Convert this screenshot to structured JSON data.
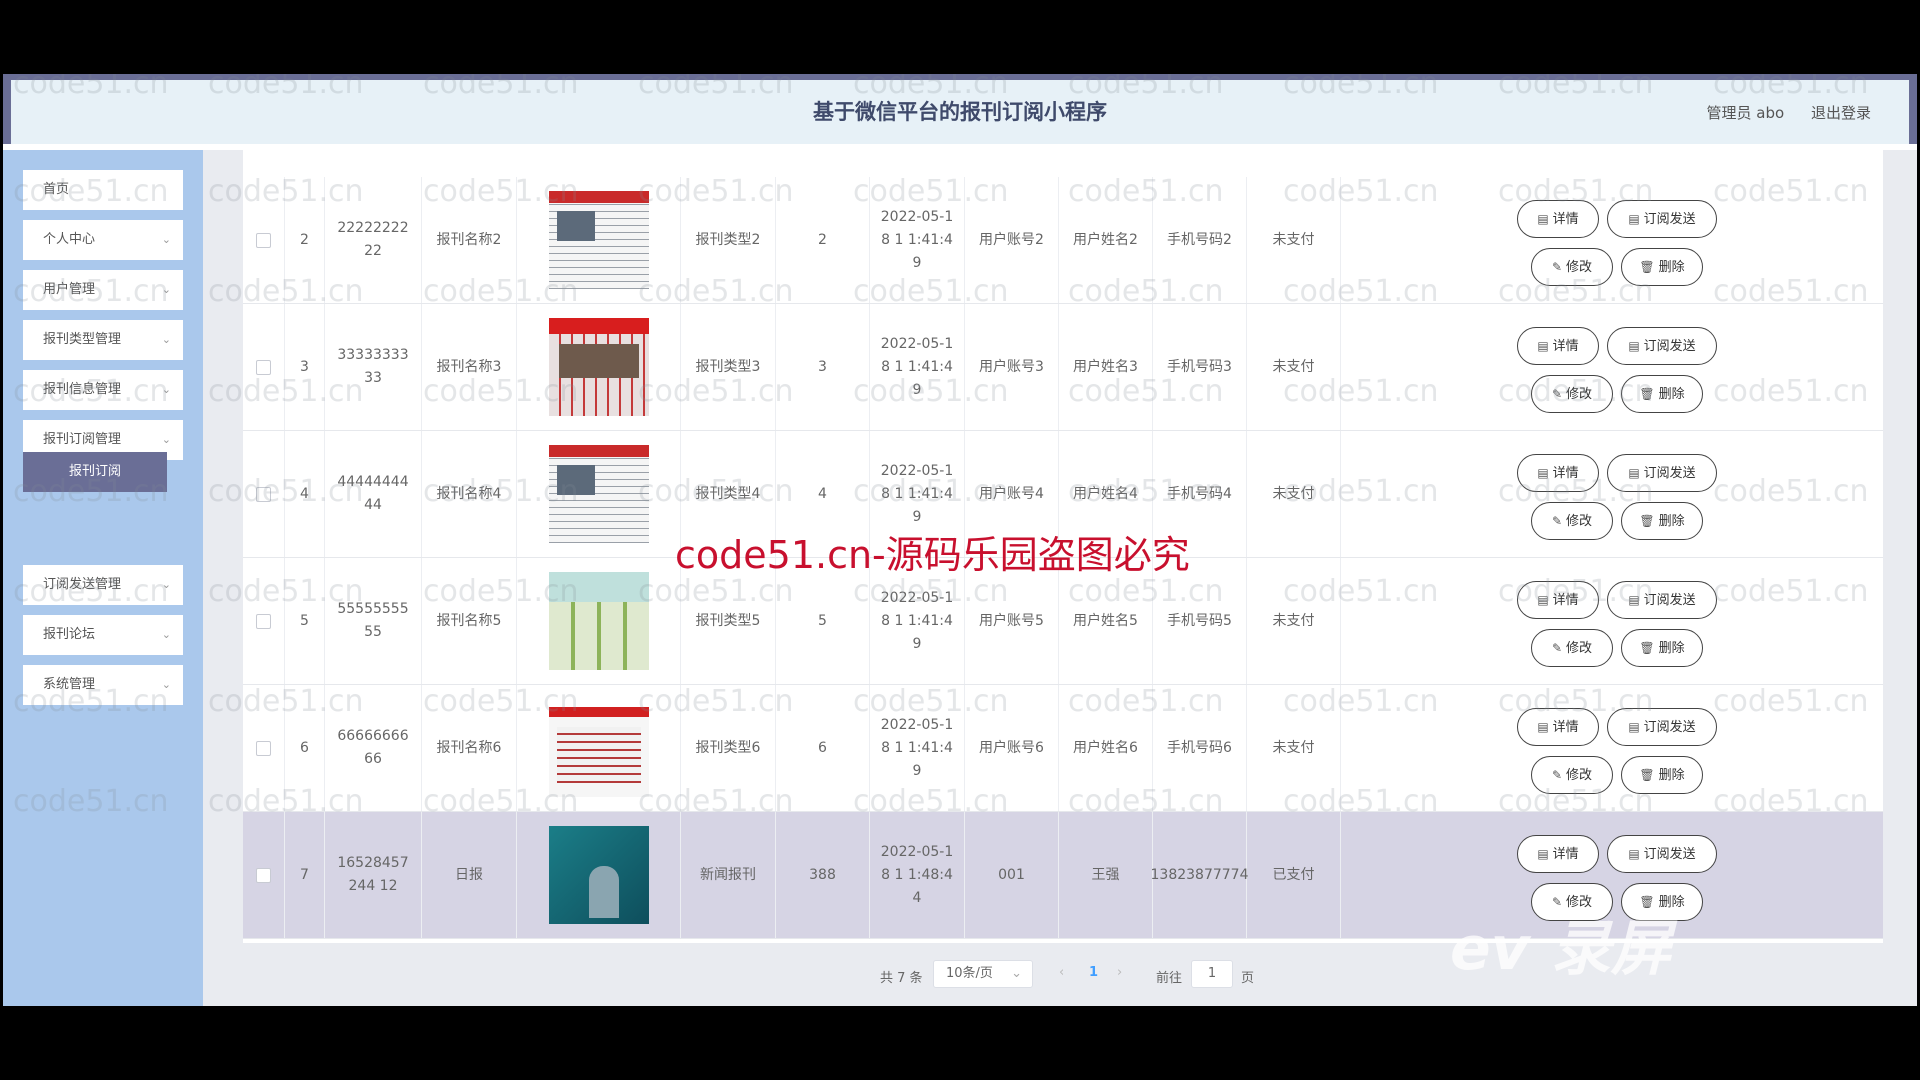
{
  "header": {
    "title": "基于微信平台的报刊订阅小程序",
    "user_label": "管理员 abo",
    "logout_label": "退出登录"
  },
  "sidebar": {
    "items": [
      {
        "label": "首页",
        "has_chevron": false
      },
      {
        "label": "个人中心",
        "has_chevron": true
      },
      {
        "label": "用户管理",
        "has_chevron": true
      },
      {
        "label": "报刊类型管理",
        "has_chevron": true
      },
      {
        "label": "报刊信息管理",
        "has_chevron": true
      },
      {
        "label": "报刊订阅管理",
        "has_chevron": true
      },
      {
        "label": "订阅发送管理",
        "has_chevron": true
      },
      {
        "label": "报刊论坛",
        "has_chevron": true
      },
      {
        "label": "系统管理",
        "has_chevron": true
      }
    ],
    "active_sub": "报刊订阅"
  },
  "rows": [
    {
      "idx": "2",
      "code": "2222222222",
      "name": "报刊名称2",
      "type": "报刊类型2",
      "count": "2",
      "time": "2022-05-18 1 1:41:49",
      "account": "用户账号2",
      "username": "用户姓名2",
      "phone": "手机号码2",
      "status": "未支付",
      "thumb": "news"
    },
    {
      "idx": "3",
      "code": "3333333333",
      "name": "报刊名称3",
      "type": "报刊类型3",
      "count": "3",
      "time": "2022-05-18 1 1:41:49",
      "account": "用户账号3",
      "username": "用户姓名3",
      "phone": "手机号码3",
      "status": "未支付",
      "thumb": "news2"
    },
    {
      "idx": "4",
      "code": "4444444444",
      "name": "报刊名称4",
      "type": "报刊类型4",
      "count": "4",
      "time": "2022-05-18 1 1:41:49",
      "account": "用户账号4",
      "username": "用户姓名4",
      "phone": "手机号码4",
      "status": "未支付",
      "thumb": "news"
    },
    {
      "idx": "5",
      "code": "5555555555",
      "name": "报刊名称5",
      "type": "报刊类型5",
      "count": "5",
      "time": "2022-05-18 1 1:41:49",
      "account": "用户账号5",
      "username": "用户姓名5",
      "phone": "手机号码5",
      "status": "未支付",
      "thumb": "green"
    },
    {
      "idx": "6",
      "code": "6666666666",
      "name": "报刊名称6",
      "type": "报刊类型6",
      "count": "6",
      "time": "2022-05-18 1 1:41:49",
      "account": "用户账号6",
      "username": "用户姓名6",
      "phone": "手机号码6",
      "status": "未支付",
      "thumb": "red"
    },
    {
      "idx": "7",
      "code": "16528457244 12",
      "name": "日报",
      "type": "新闻报刊",
      "count": "388",
      "time": "2022-05-18 1 1:48:44",
      "account": "001",
      "username": "王强",
      "phone": "13823877774",
      "status": "已支付",
      "thumb": "book",
      "selected": true
    }
  ],
  "row_actions": {
    "detail": "详情",
    "send": "订阅发送",
    "edit": "修改",
    "delete": "删除"
  },
  "pagination": {
    "total": "共 7 条",
    "page_size": "10条/页",
    "current_page": "1",
    "goto_label": "前往",
    "goto_value": "1",
    "page_unit": "页"
  },
  "watermark": {
    "text": "code51.cn",
    "notice": "code51.cn-源码乐园盗图必究",
    "logo": "ev 录屏"
  }
}
